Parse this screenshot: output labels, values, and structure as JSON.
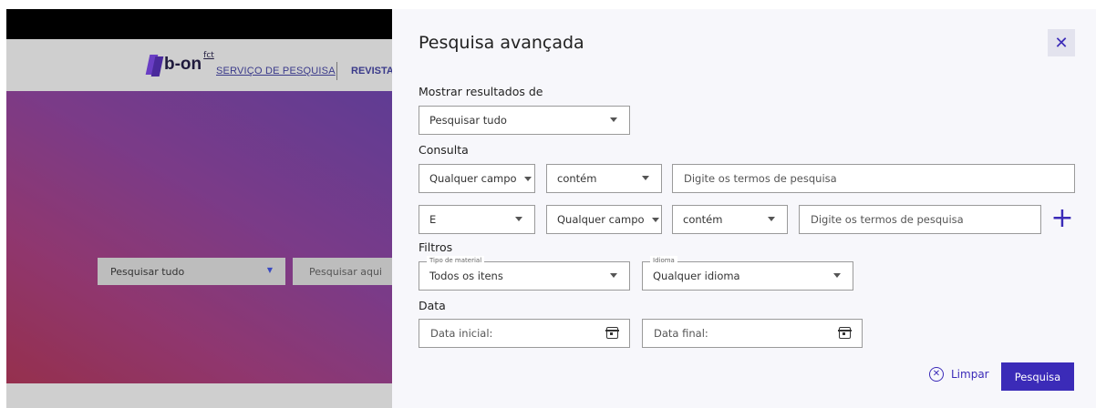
{
  "background": {
    "logo_text": "b-on",
    "logo_superscript": "fct",
    "nav_search_service": "SERVIÇO DE PESQUISA",
    "nav_journals": "REVISTAS",
    "search_select_value": "Pesquisar tudo",
    "search_input_placeholder": "Pesquisar aqui"
  },
  "panel": {
    "title": "Pesquisa avançada",
    "close_glyph": "✕",
    "show_results_label": "Mostrar resultados de",
    "show_results_value": "Pesquisar tudo",
    "query_label": "Consulta",
    "row1": {
      "field": "Qualquer campo",
      "operator": "contém",
      "placeholder": "Digite os termos de pesquisa"
    },
    "row2": {
      "boolean": "E",
      "field": "Qualquer campo",
      "operator": "contém",
      "placeholder": "Digite os termos de pesquisa"
    },
    "add_row_glyph": "+",
    "filters_label": "Filtros",
    "material_type_legend": "Tipo de material",
    "material_type_value": "Todos os itens",
    "language_legend": "Idioma",
    "language_value": "Qualquer idioma",
    "date_label": "Data",
    "start_date_placeholder": "Data inicial:",
    "end_date_placeholder": "Data final:",
    "clear_label": "Limpar",
    "clear_glyph": "✕",
    "submit_label": "Pesquisa"
  },
  "colors": {
    "accent": "#3b2bb8",
    "panel_bg": "#f7f7fb"
  }
}
